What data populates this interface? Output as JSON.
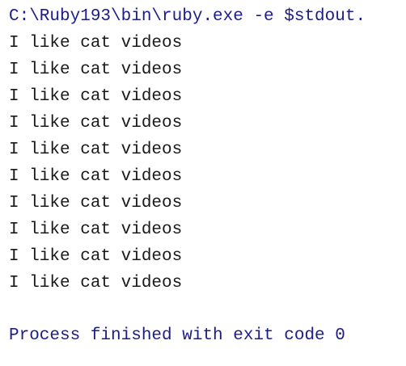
{
  "console": {
    "command": "C:\\Ruby193\\bin\\ruby.exe -e $stdout.",
    "output_lines": [
      "I like cat videos",
      "I like cat videos",
      "I like cat videos",
      "I like cat videos",
      "I like cat videos",
      "I like cat videos",
      "I like cat videos",
      "I like cat videos",
      "I like cat videos",
      "I like cat videos"
    ],
    "exit_message": "Process finished with exit code 0"
  },
  "colors": {
    "background": "#ffffff",
    "system_text": "#1c1c8c",
    "output_text": "#1a1a1a"
  }
}
